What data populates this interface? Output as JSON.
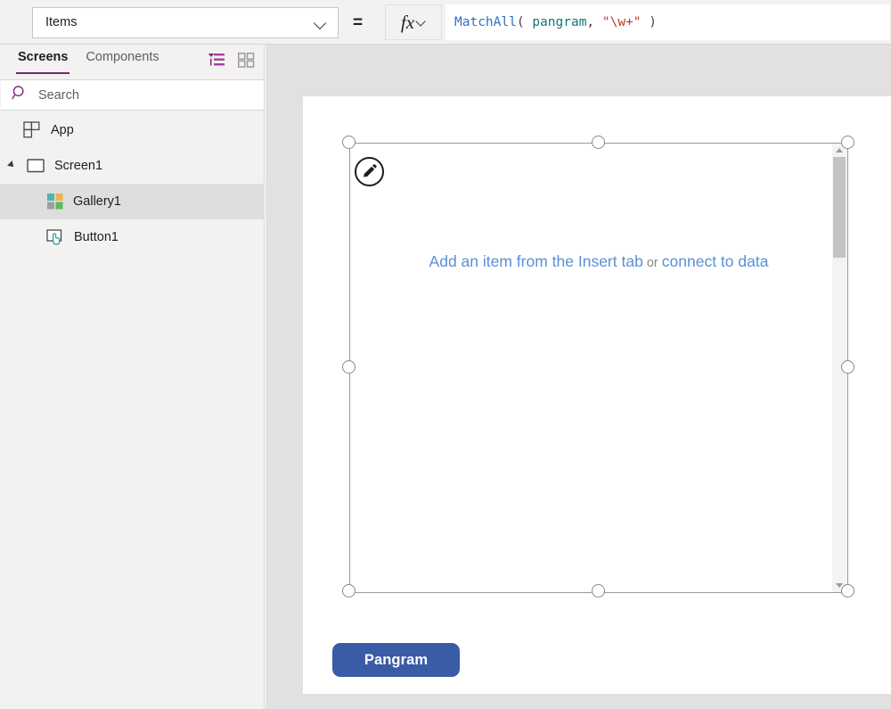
{
  "formula_bar": {
    "property_selected": "Items",
    "equals_sign": "=",
    "fx_label": "fx",
    "formula_tokens": [
      {
        "text": "MatchAll",
        "type": "fn"
      },
      {
        "text": "( ",
        "type": "punct"
      },
      {
        "text": "pangram",
        "type": "ident"
      },
      {
        "text": ", ",
        "type": "punct"
      },
      {
        "text": "\"\\w+\"",
        "type": "str"
      },
      {
        "text": " )",
        "type": "punct"
      }
    ],
    "formula_plain": "MatchAll( pangram, \"\\w+\" )"
  },
  "sidebar": {
    "tabs": [
      {
        "label": "Screens",
        "active": true
      },
      {
        "label": "Components",
        "active": false
      }
    ],
    "view_icons": [
      {
        "name": "tree-view-icon",
        "active": true
      },
      {
        "name": "thumbnail-view-icon",
        "active": false
      }
    ],
    "search": {
      "placeholder": "Search"
    },
    "tree": [
      {
        "label": "App",
        "icon": "app-icon",
        "level": 0,
        "selected": false,
        "expandable": false
      },
      {
        "label": "Screen1",
        "icon": "screen-icon",
        "level": 0,
        "selected": false,
        "expandable": true
      },
      {
        "label": "Gallery1",
        "icon": "gallery-icon",
        "level": 1,
        "selected": true,
        "expandable": false
      },
      {
        "label": "Button1",
        "icon": "button-icon",
        "level": 1,
        "selected": false,
        "expandable": false
      }
    ]
  },
  "canvas": {
    "gallery": {
      "empty_prefix": "Add an item from the Insert tab",
      "empty_middle": " or ",
      "empty_suffix": "connect to data",
      "scrollbar_present": true
    },
    "button": {
      "label": "Pangram"
    }
  },
  "colors": {
    "accent_purple": "#742774",
    "button_blue": "#3a5ba5",
    "link_blue": "#5b8fd6",
    "chrome_gray": "#f3f2f1",
    "canvas_gray": "#e1e1e1",
    "formula_fn": "#2c72c7",
    "formula_ident": "#0f7878",
    "formula_string": "#c0392b"
  }
}
